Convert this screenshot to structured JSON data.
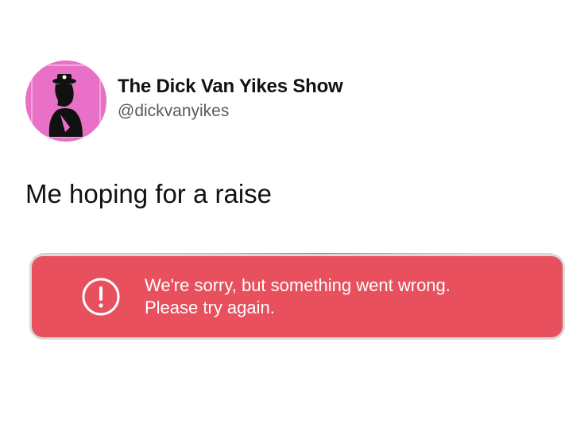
{
  "tweet": {
    "display_name": "The Dick Van Yikes Show",
    "handle": "@dickvanyikes",
    "text": "Me hoping for a raise"
  },
  "error": {
    "line1": "We're sorry, but something went wrong.",
    "line2": "Please try again.",
    "icon": "alert-circle-icon",
    "color": "#e9505e"
  },
  "avatar": {
    "background": "#e871c7"
  }
}
